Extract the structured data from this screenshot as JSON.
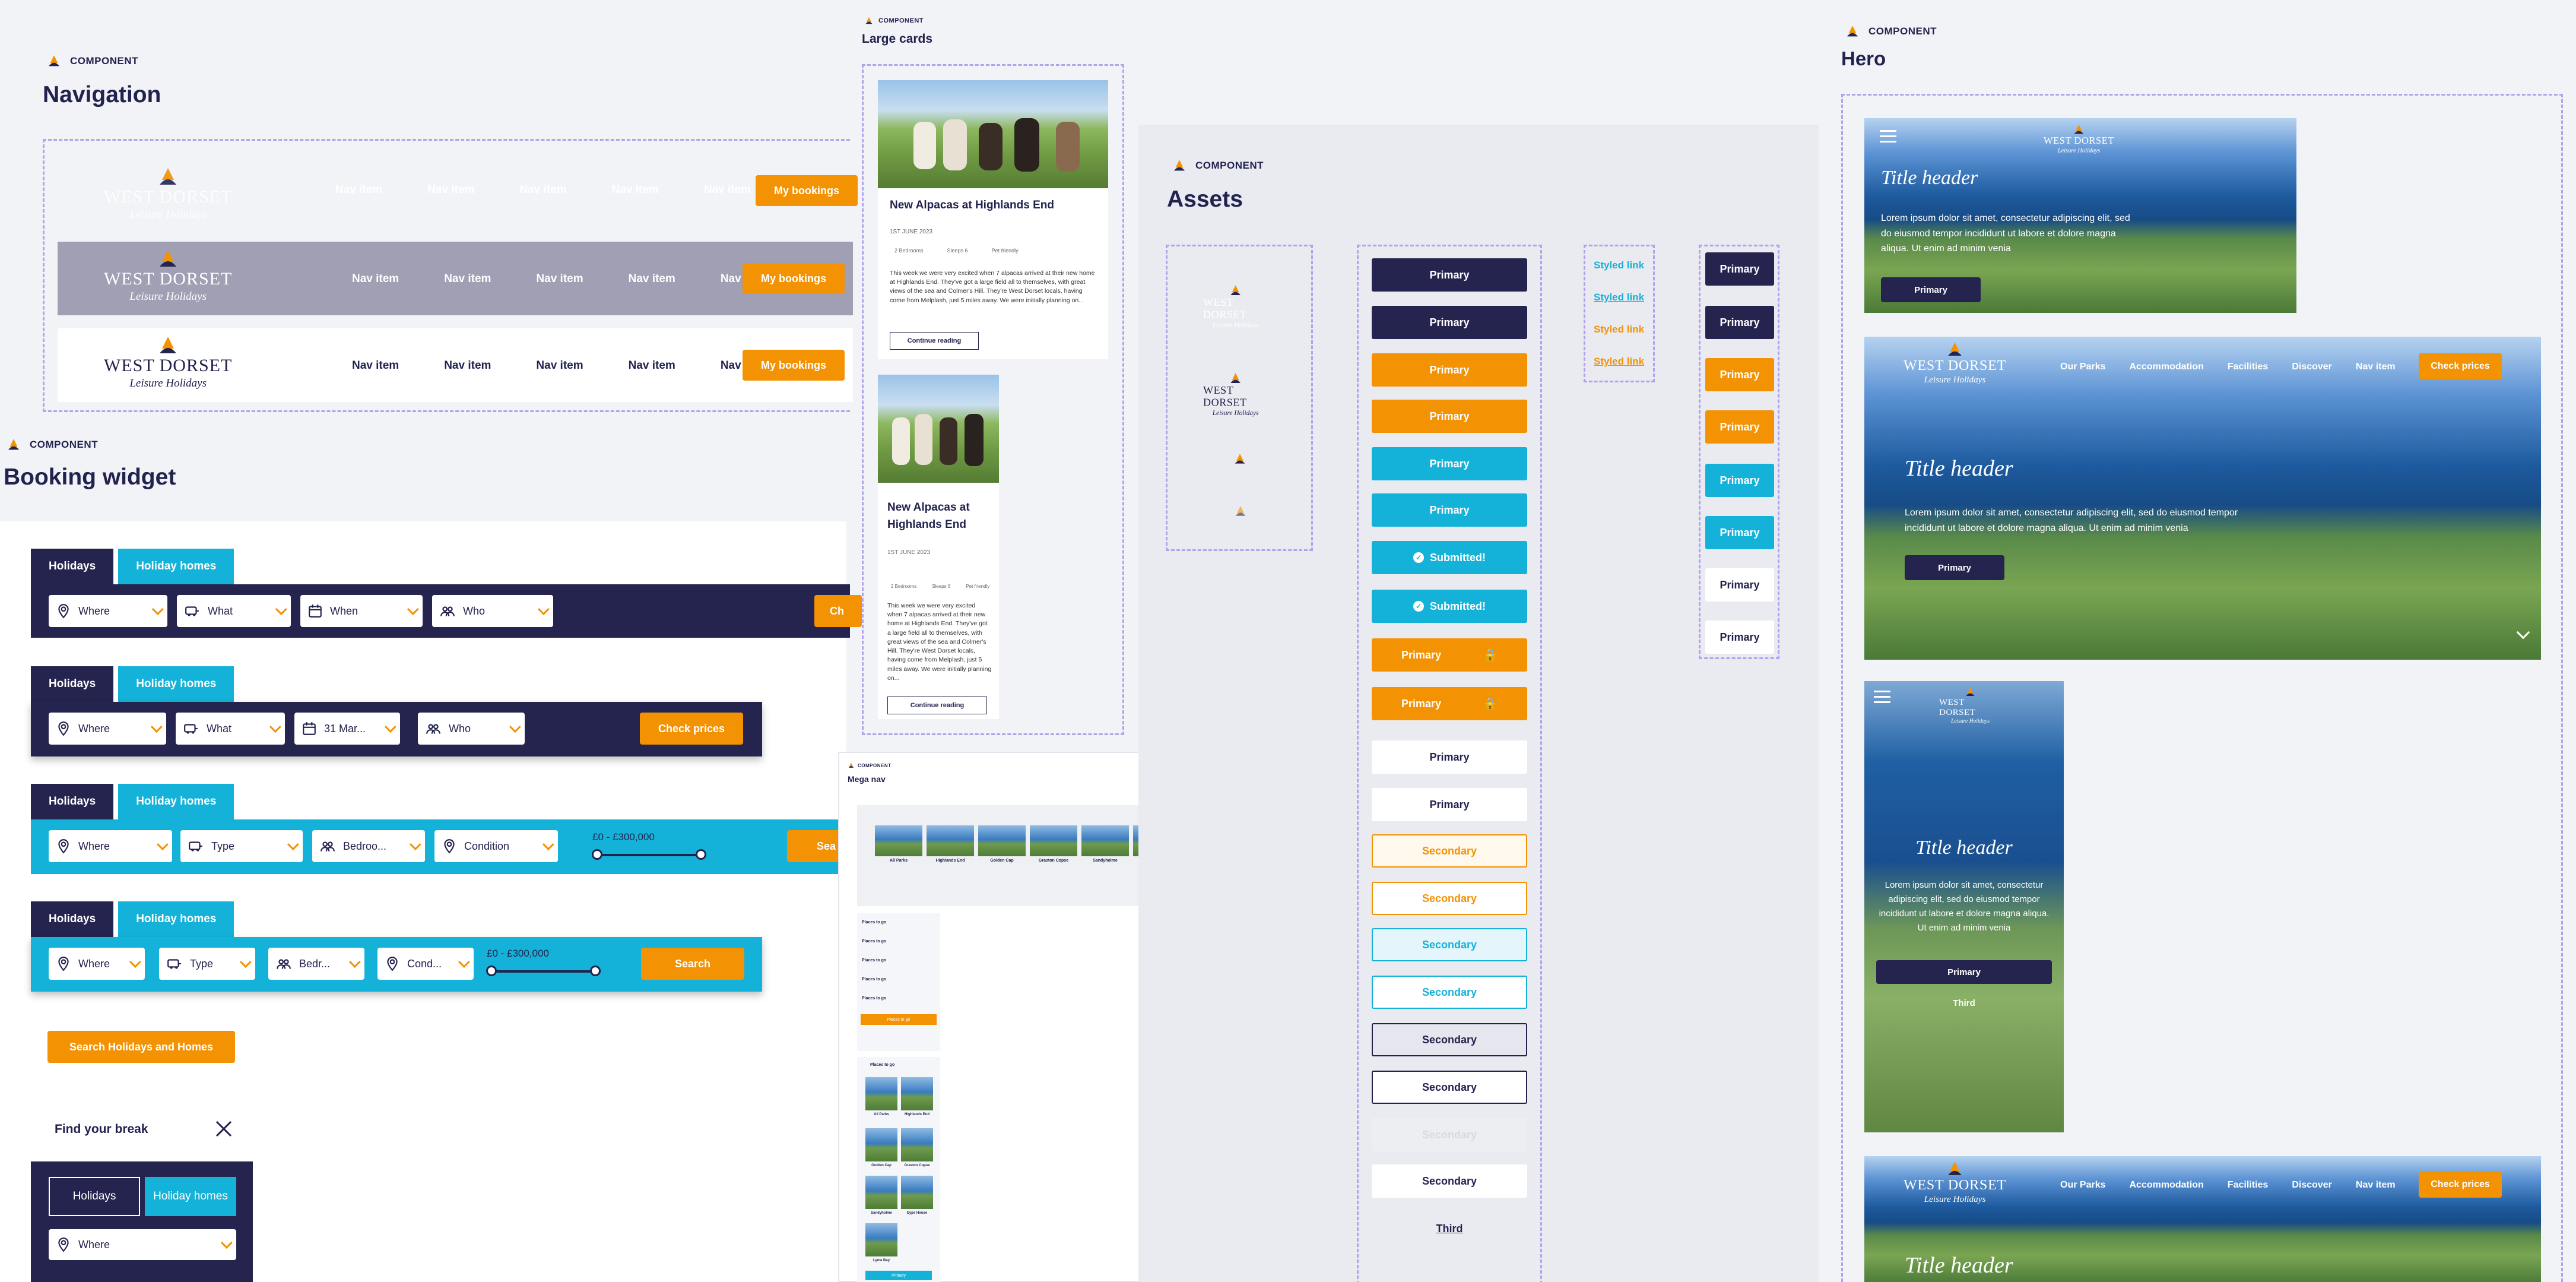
{
  "component_label": "COMPONENT",
  "navigation": {
    "title": "Navigation",
    "logo_text": "WEST DORSET",
    "logo_script": "Leisure Holidays",
    "nav_items": [
      "Nav item",
      "Nav item",
      "Nav item",
      "Nav item",
      "Nav item"
    ],
    "cta": "My bookings"
  },
  "booking": {
    "title": "Booking widget",
    "tab_holidays": "Holidays",
    "tab_homes": "Holiday homes",
    "where": "Where",
    "what": "What",
    "when": "When",
    "when_filled": "31 Mar...",
    "who": "Who",
    "type": "Type",
    "bedrooms": "Bedroo...",
    "bedrooms_short": "Bedr...",
    "condition": "Condition",
    "condition_short": "Cond...",
    "price_range": "£0 - £300,000",
    "check_prices": "Check prices",
    "check_prices_cut": "Ch",
    "search": "Search",
    "search_cut": "Sea",
    "search_all": "Search Holidays and Homes",
    "find_break": "Find your break"
  },
  "cards": {
    "title": "Large cards",
    "card_title": "New Alpacas at Highlands End",
    "date": "1ST JUNE 2023",
    "meta": [
      "2 Bedrooms",
      "Sleeps 6",
      "Pet friendly"
    ],
    "body": "This week we were very excited when 7 alpacas arrived at their new home at Highlands End. They've got a large field all to themselves, with great views of the sea and Colmer's Hill. They're West Dorset locals, having come from Melplash, just 5 miles away. We were initially planning on...",
    "cta": "Continue reading"
  },
  "mega": {
    "title": "Mega nav",
    "thumbs": [
      "All Parks",
      "Highlands End",
      "Golden Cap",
      "Graston Copse",
      "Sandyholme",
      "Eype House",
      "Lyme Bay"
    ],
    "primary": "Primary",
    "places": [
      "Places to go",
      "Places to go",
      "Places to go",
      "Places to go",
      "Places to go"
    ],
    "places_btn": "Places to go",
    "back_label": "Places to go"
  },
  "assets": {
    "title": "Assets",
    "primary": "Primary",
    "submitted": "Submitted!",
    "secondary": "Secondary",
    "third": "Third",
    "styled_link": "Styled link"
  },
  "hero": {
    "title": "Hero",
    "heading": "Title header",
    "body": "Lorem ipsum dolor sit amet, consectetur adipiscing elit, sed do eiusmod tempor incididunt ut labore et dolore magna aliqua. Ut enim ad minim venia",
    "cta": "Primary",
    "third": "Third",
    "nav": [
      "Our Parks",
      "Accommodation",
      "Facilities",
      "Discover",
      "Nav item"
    ],
    "check_prices": "Check prices"
  },
  "colors": {
    "navy": "#25244f",
    "orange": "#f39203",
    "cyan": "#14b2d8",
    "purple_dash": "#b3a0f0"
  }
}
